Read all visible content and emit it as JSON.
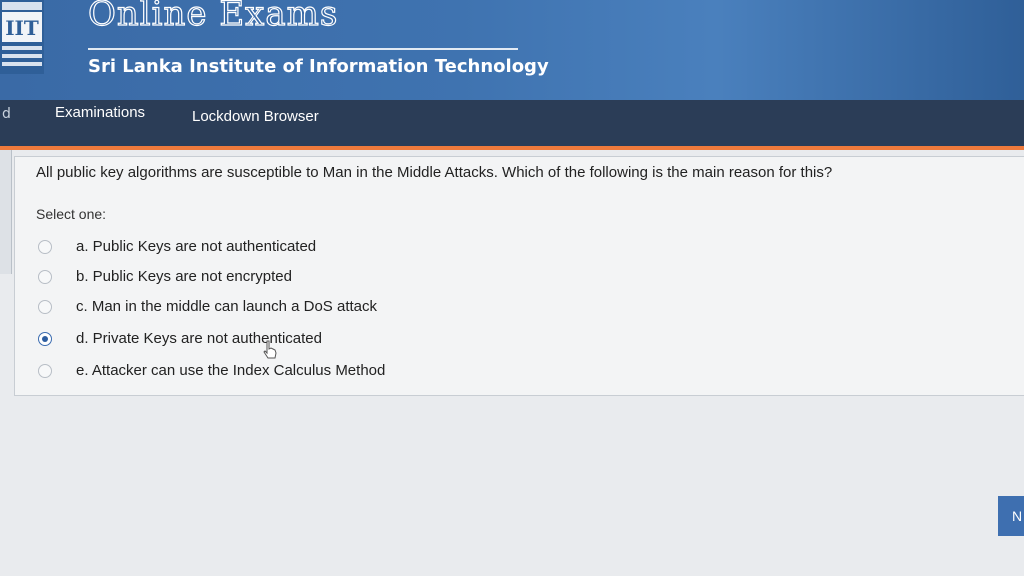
{
  "header": {
    "site_title": "Online Exams",
    "institute": "Sri Lanka Institute of Information Technology",
    "logo_text": "IIT"
  },
  "nav": {
    "left_glyph": "d",
    "items": [
      {
        "label": "Examinations"
      },
      {
        "label": "Lockdown Browser"
      }
    ]
  },
  "question": {
    "text": "All public key algorithms are susceptible to Man in the Middle Attacks. Which of the following is the main reason for this?",
    "prompt": "Select one:",
    "options": [
      {
        "label": "a. Public Keys are not authenticated",
        "selected": false
      },
      {
        "label": "b. Public Keys are not encrypted",
        "selected": false
      },
      {
        "label": "c. Man in the middle can launch a DoS attack",
        "selected": false
      },
      {
        "label": "d. Private Keys are not authenticated",
        "selected": true
      },
      {
        "label": "e. Attacker can use the Index Calculus Method",
        "selected": false
      }
    ]
  },
  "next_button": {
    "label": "N"
  },
  "colors": {
    "header_blue": "#3f73b0",
    "nav_dark": "#2b3d57",
    "accent_orange": "#ee7a3c",
    "radio_selected": "#2d5da0"
  }
}
